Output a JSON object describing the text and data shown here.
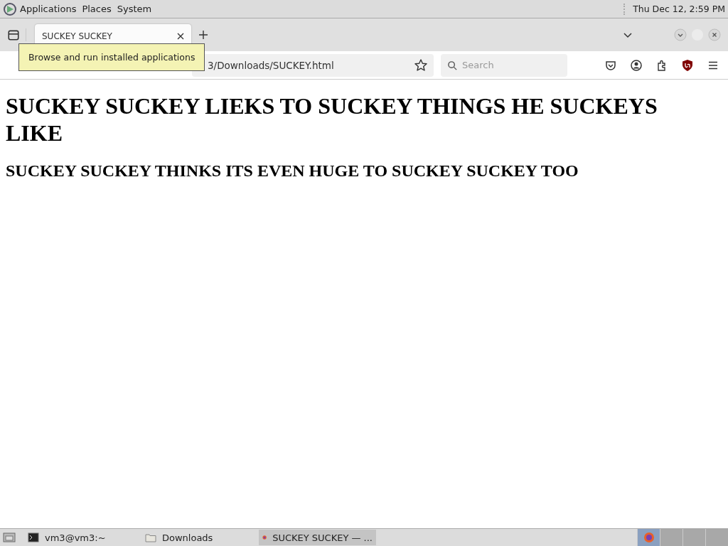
{
  "top_panel": {
    "menus": [
      "Applications",
      "Places",
      "System"
    ],
    "clock": "Thu Dec 12,  2:59 PM"
  },
  "tooltip": {
    "text": "Browse and run installed applications"
  },
  "browser": {
    "tabs": [
      {
        "title": "SUCKEY SUCKEY",
        "selected": true
      }
    ],
    "address": "3/Downloads/SUCKEY.html",
    "search": {
      "placeholder": "Search"
    }
  },
  "page": {
    "heading": "SUCKEY SUCKEY LIEKS TO SUCKEY THINGS HE SUCKEYS LIKE",
    "subheading": "SUCKEY SUCKEY THINKS ITS EVEN HUGE TO SUCKEY SUCKEY TOO"
  },
  "taskbar": {
    "items": [
      {
        "kind": "terminal",
        "label": "vm3@vm3:~",
        "selected": false
      },
      {
        "kind": "folder",
        "label": "Downloads",
        "selected": false
      },
      {
        "kind": "browser",
        "label": "SUCKEY SUCKEY — ...",
        "selected": true
      }
    ]
  }
}
